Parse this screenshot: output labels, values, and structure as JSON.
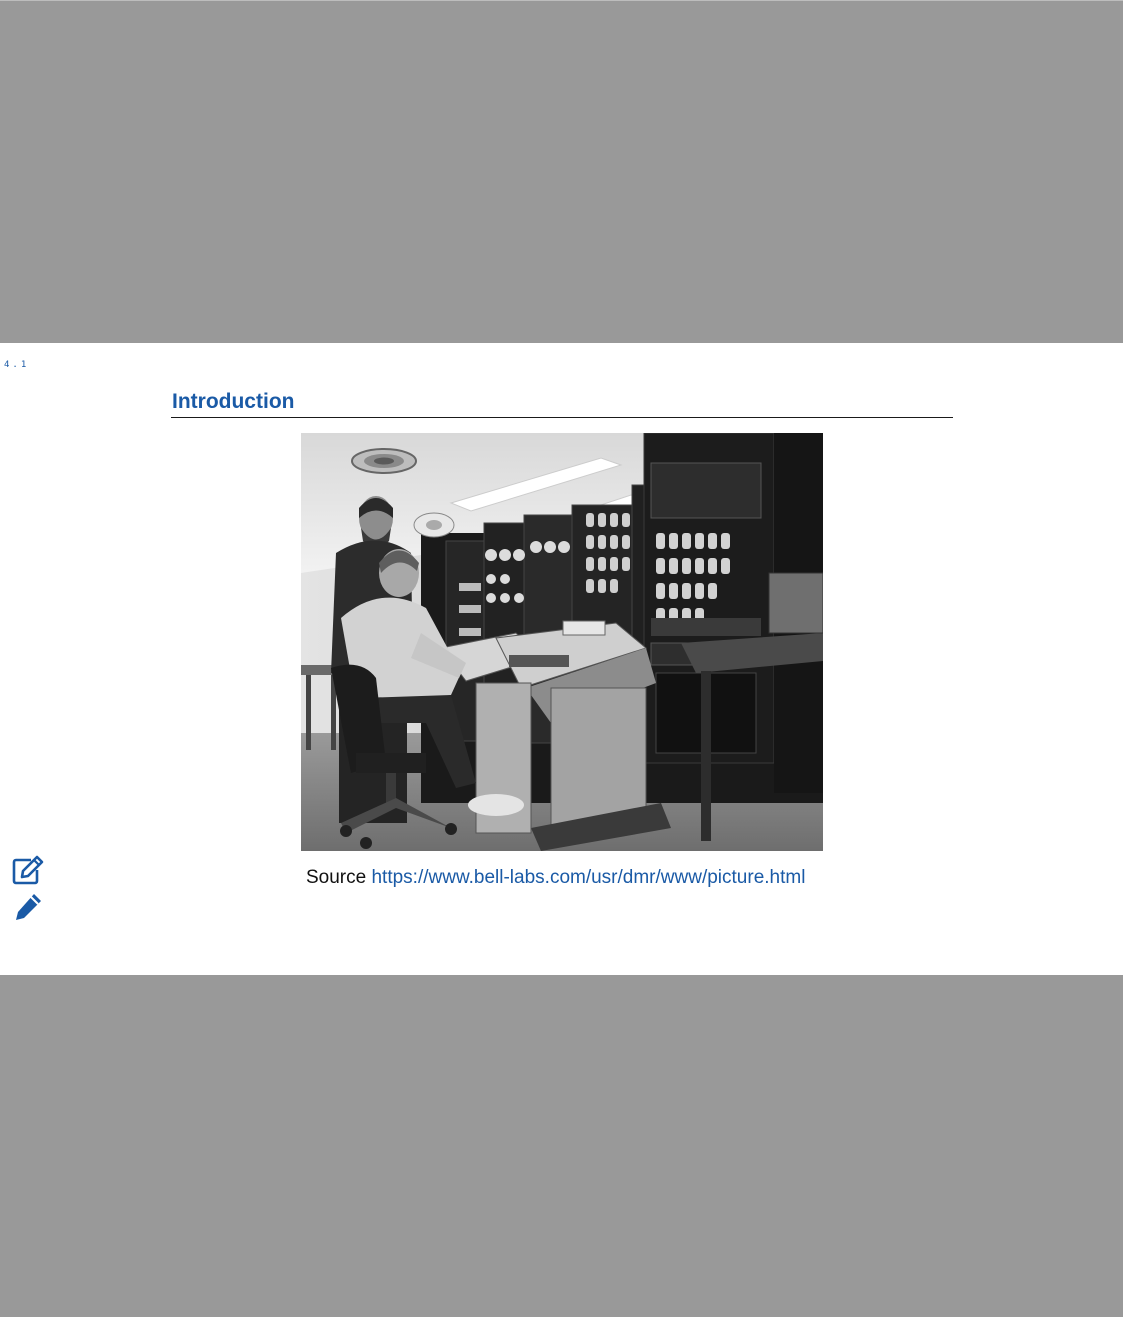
{
  "slide": {
    "number": "4.1",
    "title": "Introduction"
  },
  "figure": {
    "image_subject": "two men working at a large room-sized minicomputer with teletype terminals (black and white photo)"
  },
  "caption": {
    "prefix": "Source",
    "link_text": "https://www.bell-labs.com/usr/dmr/www/picture.html"
  },
  "tools": {
    "edit_icon": "edit-square-icon",
    "pencil_icon": "pencil-icon"
  },
  "colors": {
    "accent": "#1a5aa6",
    "background_outer": "#999999",
    "slide_background": "#ffffff"
  }
}
